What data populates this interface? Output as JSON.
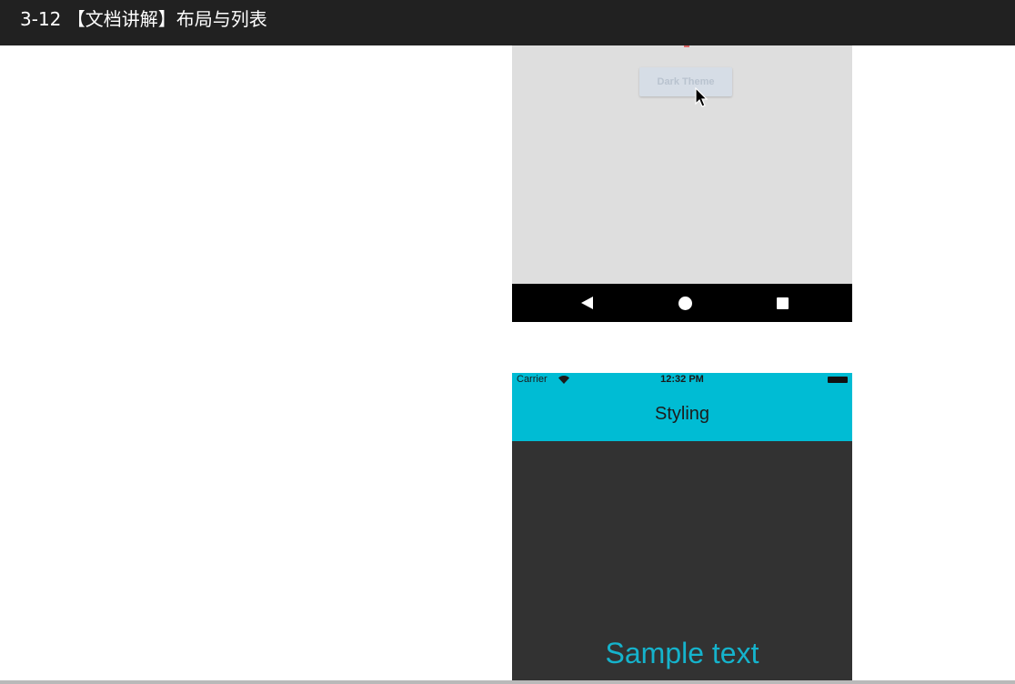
{
  "window": {
    "title": "3-12 【文档讲解】布局与列表"
  },
  "android_preview": {
    "button_label": "Dark Theme",
    "nav_icons": [
      "back-triangle-icon",
      "home-circle-icon",
      "recents-square-icon"
    ],
    "background": "#dedede",
    "navbar_color": "#000000"
  },
  "ios_preview": {
    "status": {
      "carrier": "Carrier",
      "time": "12:32 PM"
    },
    "nav_title": "Styling",
    "sample_text": "Sample text",
    "colors": {
      "header": "#00bcd4",
      "body": "#323232",
      "sample_text": "#15b3cc"
    }
  }
}
